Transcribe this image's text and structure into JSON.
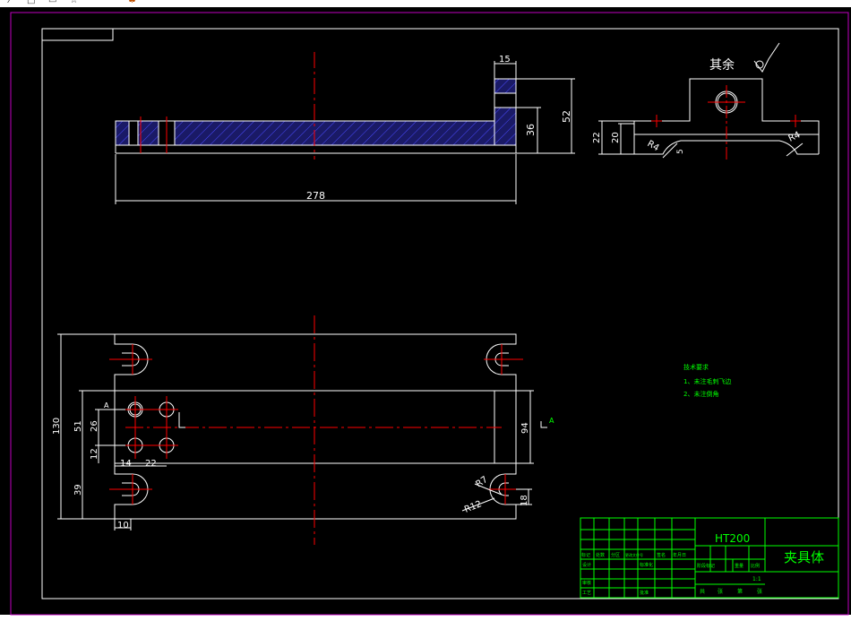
{
  "toolbar": {
    "icons": [
      "pointer-icon",
      "rectangle-icon",
      "window-icon",
      "star-icon",
      "paint-icon"
    ]
  },
  "colors": {
    "background": "#000000",
    "frame": "#ffffff",
    "centerline": "#ff0000",
    "hatch": "#3333cc",
    "notes": "#00ff00",
    "viewport_border": "#c000c0"
  },
  "top_view": {
    "dim_width": "278",
    "dim_lug": "15",
    "dim_height_inner": "36",
    "dim_height_total": "52"
  },
  "side_view": {
    "roughness_label": "其余",
    "dim_22": "22",
    "dim_20": "20",
    "radius_left": "R4",
    "radius_right": "R4",
    "dim_5": "5"
  },
  "plan_view": {
    "dim_130": "130",
    "dim_51": "51",
    "dim_26": "26",
    "dim_12": "12",
    "dim_39": "39",
    "dim_14": "14",
    "dim_22": "22",
    "dim_10": "10",
    "dim_94": "94",
    "dim_18": "18",
    "radius_7": "R7",
    "radius_12": "R12",
    "section_a_left": "A",
    "section_a_right": "A"
  },
  "notes": {
    "title": "技术要求",
    "line1": "1、未注毛刺飞边",
    "line2": "2、未注倒角"
  },
  "title_block": {
    "material": "HT200",
    "part_name": "夹具体",
    "row_headers": [
      "标记",
      "处数",
      "分区",
      "更改文件号",
      "签名",
      "年月日"
    ],
    "designer": "设计",
    "standardization": "标准化",
    "stage_mark": "阶段标记",
    "weight": "重量",
    "scale": "比例",
    "scale_value": "1:1",
    "review": "审核",
    "process": "工艺",
    "approve": "批准",
    "sheet_text": [
      "共",
      "张",
      "第",
      "张"
    ]
  }
}
